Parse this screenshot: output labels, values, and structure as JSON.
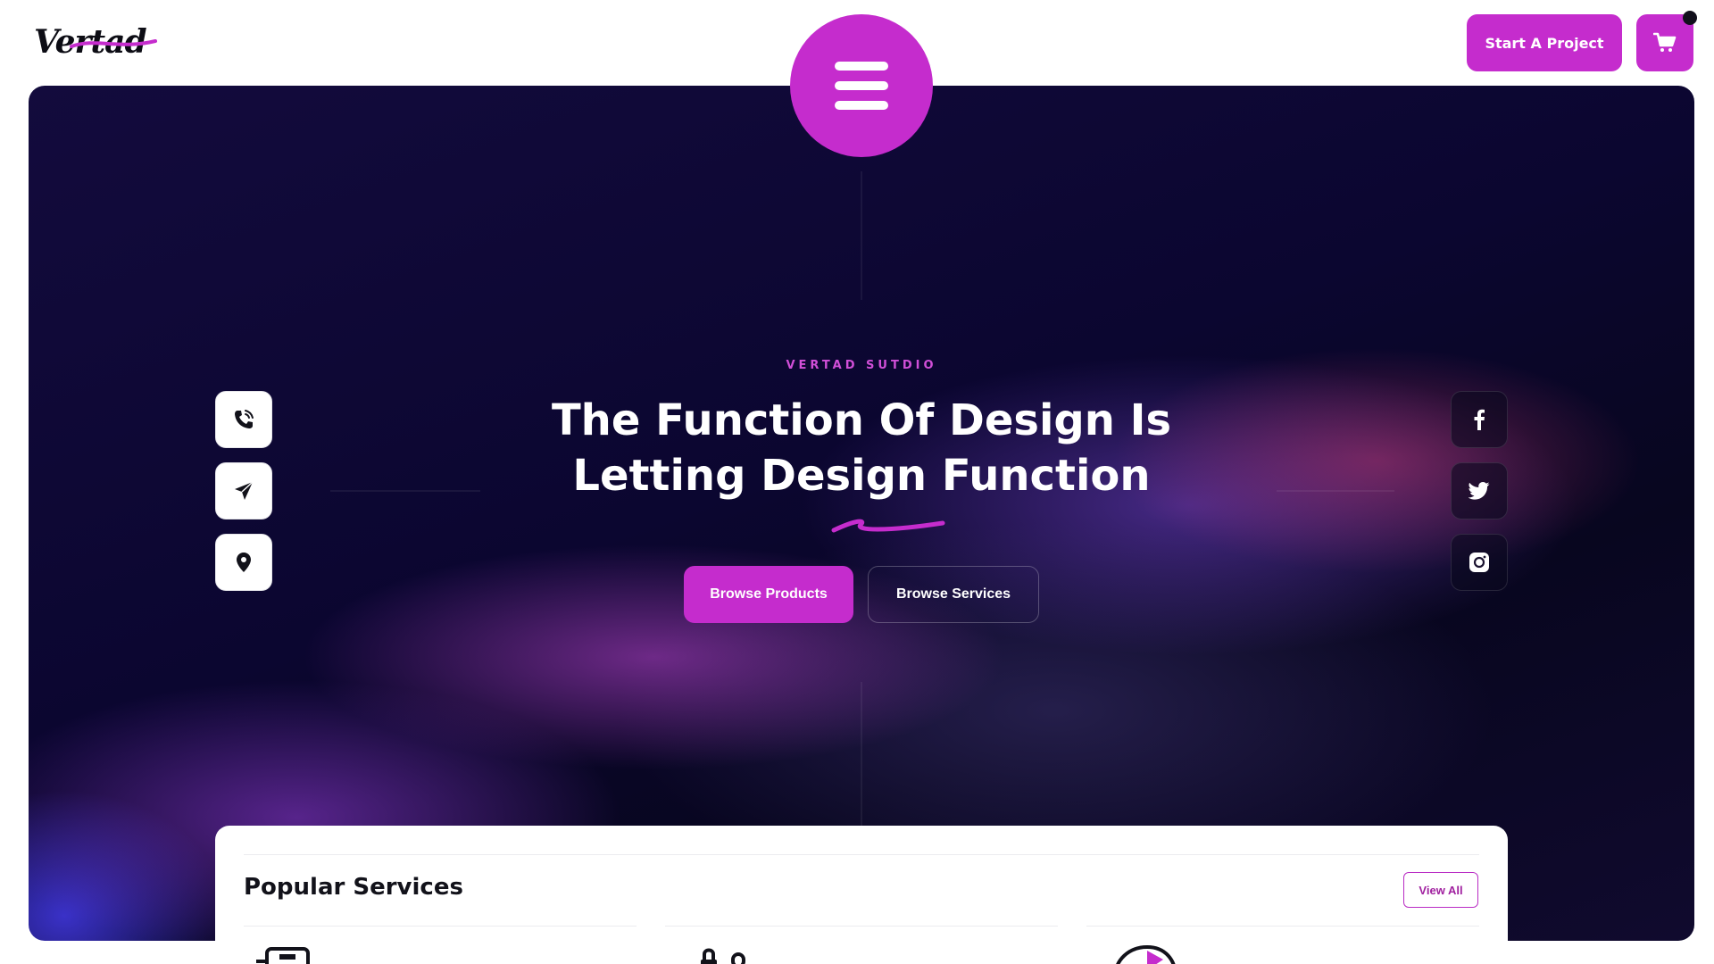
{
  "header": {
    "logo_text": "Vertad",
    "start_project_label": "Start A Project",
    "cart_icon": "cart-icon",
    "menu_icon": "hamburger-menu-icon"
  },
  "hero": {
    "eyebrow": "VERTAD SUTDIO",
    "headline_line1": "The Function Of Design Is",
    "headline_line2": "Letting Design Function",
    "browse_products_label": "Browse Products",
    "browse_services_label": "Browse Services",
    "contact_icons": [
      "phone-icon",
      "send-icon",
      "location-pin-icon"
    ],
    "social_icons": [
      "facebook-icon",
      "twitter-icon",
      "instagram-icon"
    ]
  },
  "services": {
    "title": "Popular Services",
    "view_all_label": "View All",
    "service_icons": [
      "monitor-icon",
      "lock-icon",
      "chart-icon"
    ]
  },
  "colors": {
    "accent": "#c52ccd",
    "hero_dark": "#0b0630",
    "text_dark": "#12121a"
  }
}
